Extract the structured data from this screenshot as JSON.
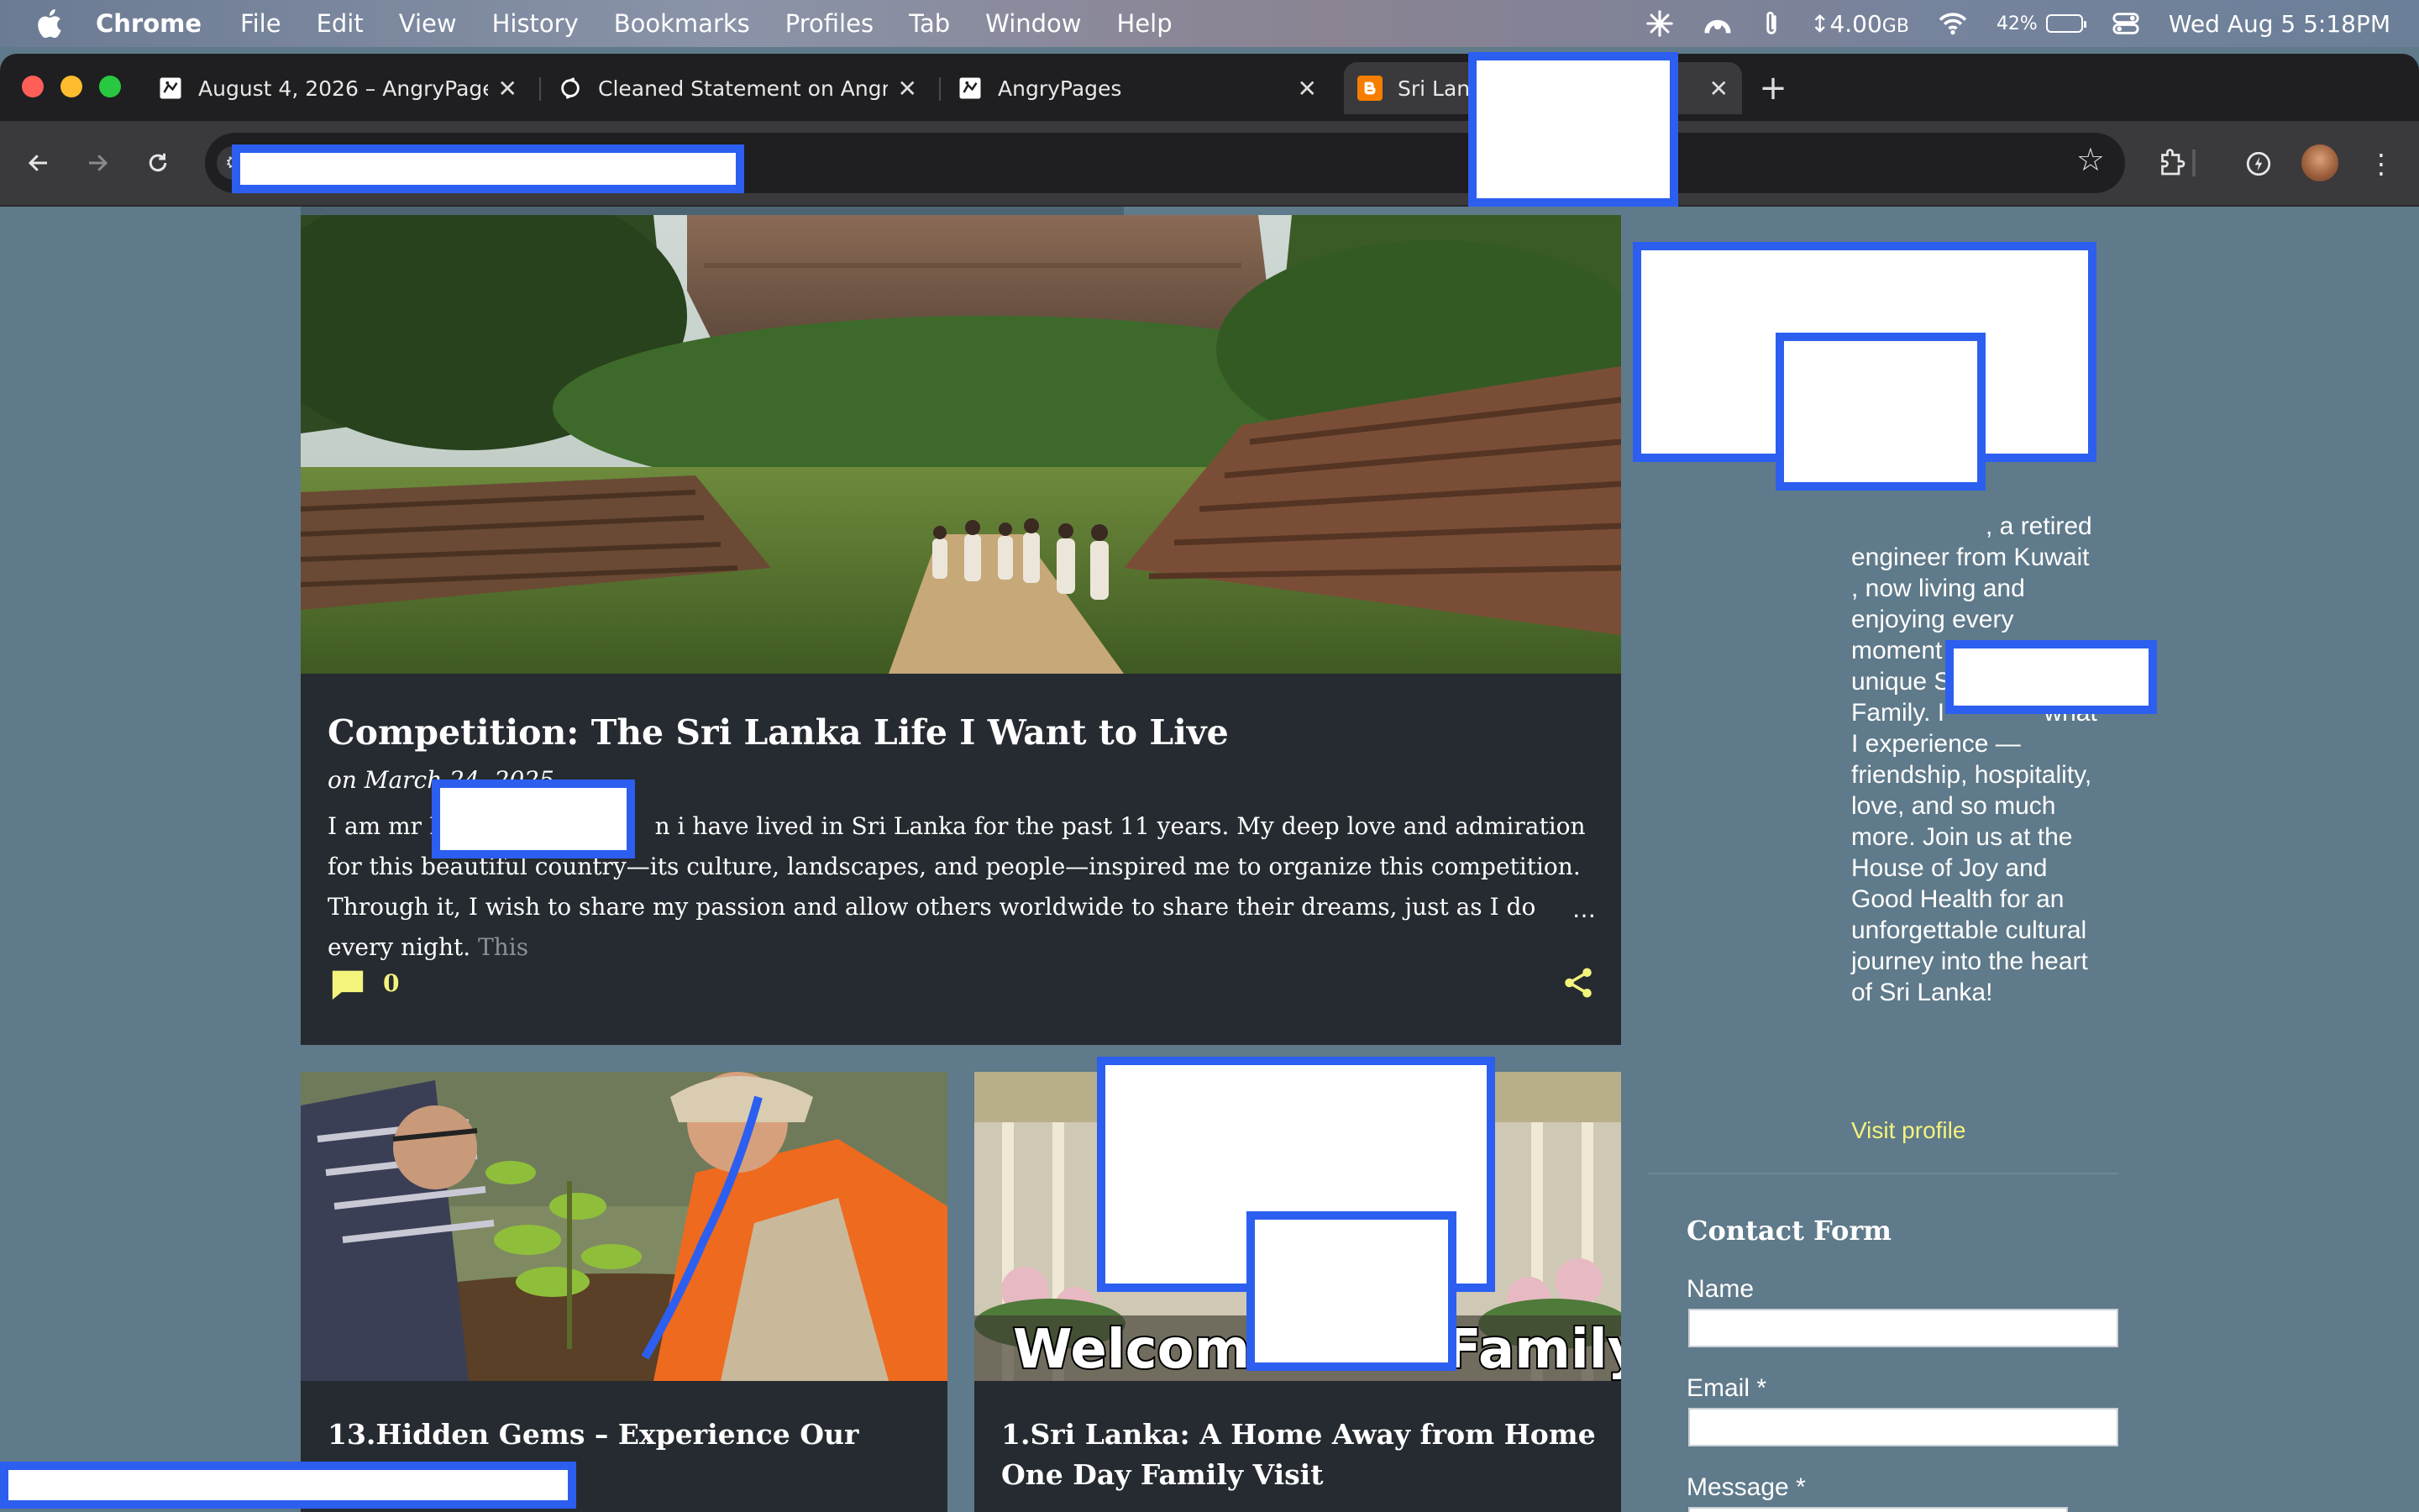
{
  "menubar": {
    "app": "Chrome",
    "items": [
      "File",
      "Edit",
      "View",
      "History",
      "Bookmarks",
      "Profiles",
      "Tab",
      "Window",
      "Help"
    ],
    "storage": "4.00",
    "storage_unit": "GB",
    "battery": "42%",
    "battery_level": 0.42,
    "datetime": "Wed Aug 5  5:18PM"
  },
  "tabs": [
    {
      "label": "August 4, 2026 – AngryPages",
      "icon": "angrypages-icon"
    },
    {
      "label": "Cleaned Statement on AngryPages",
      "icon": "sync-icon"
    },
    {
      "label": "AngryPages",
      "icon": "angrypages-icon"
    },
    {
      "label": "Sri Lanka",
      "icon": "blogger-icon",
      "active": true
    }
  ],
  "post": {
    "title": "Competition: The Sri Lanka Life I Want to Live",
    "date": "on March 24, 2025",
    "snippet_1": "I am mr M",
    "snippet_2": "n i have  lived in Sri Lanka for the past 11 years.  My deep love and admiration for this beautiful country—its culture, landscapes, and people—inspired me to organize this competition.  Through it, I wish to share my passion and allow others worldwide to share their dreams, just as I do every night.  ",
    "snippet_fade": "This",
    "ellipsis": "…",
    "comments": "0"
  },
  "cards": [
    {
      "title": "13.Hidden Gems – Experience Our Home"
    },
    {
      "title": "1.Sri Lanka: A Home Away from Home One Day Family Visit",
      "banner_left": "Welcome to",
      "banner_right": "Family"
    }
  ],
  "sidebar": {
    "profile_text": ", a retired engineer from Kuwait , now living and enjoying every moment with my unique Sri Lankan ",
    "profile_text_2": "Family. I",
    "profile_text_3": "what I experience —friendship, hospitality, love, and so much more. Join us at the House of Joy and Good Health for an unforgettable cultural journey into the heart of Sri Lanka!",
    "visit_profile": "Visit profile",
    "contact_title": "Contact Form",
    "name_label": "Name",
    "email_label": "Email *",
    "message_label": "Message *"
  },
  "colors": {
    "page_bg": "#5f7a8a",
    "card_bg": "#262b31",
    "accent": "#f4f37c",
    "redaction_border": "#2c5ff0"
  }
}
